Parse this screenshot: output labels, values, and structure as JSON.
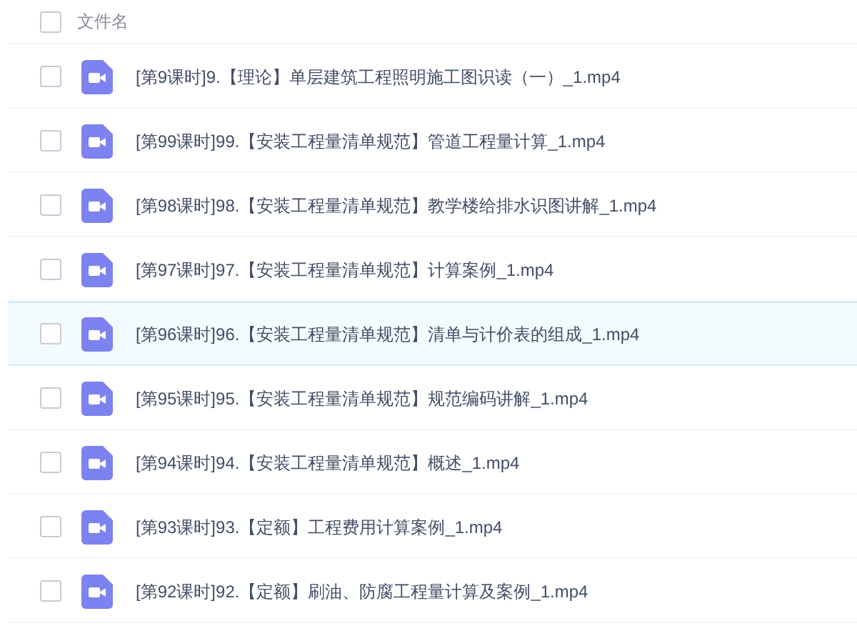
{
  "header": {
    "checked": false,
    "label": "文件名"
  },
  "files": [
    {
      "name": "[第9课时]9.【理论】单层建筑工程照明施工图识读（一）_1.mp4",
      "checked": false,
      "highlighted": false
    },
    {
      "name": "[第99课时]99.【安装工程量清单规范】管道工程量计算_1.mp4",
      "checked": false,
      "highlighted": false
    },
    {
      "name": "[第98课时]98.【安装工程量清单规范】教学楼给排水识图讲解_1.mp4",
      "checked": false,
      "highlighted": false
    },
    {
      "name": "[第97课时]97.【安装工程量清单规范】计算案例_1.mp4",
      "checked": false,
      "highlighted": false
    },
    {
      "name": "[第96课时]96.【安装工程量清单规范】清单与计价表的组成_1.mp4",
      "checked": false,
      "highlighted": true
    },
    {
      "name": "[第95课时]95.【安装工程量清单规范】规范编码讲解_1.mp4",
      "checked": false,
      "highlighted": false
    },
    {
      "name": "[第94课时]94.【安装工程量清单规范】概述_1.mp4",
      "checked": false,
      "highlighted": false
    },
    {
      "name": "[第93课时]93.【定额】工程费用计算案例_1.mp4",
      "checked": false,
      "highlighted": false
    },
    {
      "name": "[第92课时]92.【定额】刷油、防腐工程量计算及案例_1.mp4",
      "checked": false,
      "highlighted": false
    }
  ]
}
